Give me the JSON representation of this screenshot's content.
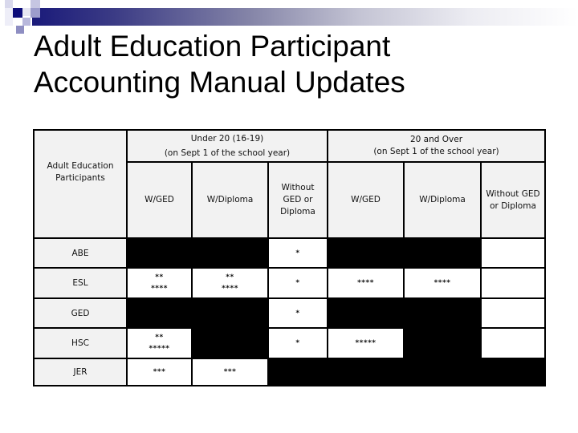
{
  "slide": {
    "title_lines": [
      "Adult Education Participant",
      "Accounting Manual Updates"
    ],
    "accent_colors": {
      "bar_dark": "#1a1a7a",
      "logo_dark": "#0d0d7a",
      "header_fill": "#f2f2f2",
      "blocked_fill": "#000000"
    }
  },
  "table": {
    "row_header_label": "Adult Education Participants",
    "groups": [
      {
        "label_lines": [
          "Under 20 (16-19)",
          "(on Sept 1 of the school year)"
        ]
      },
      {
        "label_lines": [
          "20 and Over",
          "(on Sept 1 of the school year)"
        ]
      }
    ],
    "columns": [
      {
        "label_lines": [
          "W/GED"
        ]
      },
      {
        "label_lines": [
          "W/Diploma"
        ]
      },
      {
        "label_lines": [
          "Without",
          "GED or",
          "Diploma"
        ]
      },
      {
        "label_lines": [
          "W/GED"
        ]
      },
      {
        "label_lines": [
          "W/Diploma"
        ]
      },
      {
        "label_lines": [
          "Without GED",
          "or Diploma"
        ]
      }
    ],
    "rows": [
      {
        "label": "ABE",
        "cells": [
          {
            "allowed": false,
            "marks": []
          },
          {
            "allowed": false,
            "marks": []
          },
          {
            "allowed": true,
            "marks": [
              "*"
            ]
          },
          {
            "allowed": false,
            "marks": []
          },
          {
            "allowed": false,
            "marks": []
          },
          {
            "allowed": true,
            "marks": []
          }
        ]
      },
      {
        "label": "ESL",
        "cells": [
          {
            "allowed": true,
            "marks": [
              "**",
              "****"
            ]
          },
          {
            "allowed": true,
            "marks": [
              "**",
              "****"
            ]
          },
          {
            "allowed": true,
            "marks": [
              "*"
            ]
          },
          {
            "allowed": true,
            "marks": [
              "****"
            ]
          },
          {
            "allowed": true,
            "marks": [
              "****"
            ]
          },
          {
            "allowed": true,
            "marks": []
          }
        ]
      },
      {
        "label": "GED",
        "cells": [
          {
            "allowed": false,
            "marks": []
          },
          {
            "allowed": false,
            "marks": []
          },
          {
            "allowed": true,
            "marks": [
              "*"
            ]
          },
          {
            "allowed": false,
            "marks": []
          },
          {
            "allowed": false,
            "marks": []
          },
          {
            "allowed": true,
            "marks": []
          }
        ]
      },
      {
        "label": "HSC",
        "cells": [
          {
            "allowed": true,
            "marks": [
              "**",
              "*****"
            ]
          },
          {
            "allowed": false,
            "marks": []
          },
          {
            "allowed": true,
            "marks": [
              "*"
            ]
          },
          {
            "allowed": true,
            "marks": [
              "*****"
            ]
          },
          {
            "allowed": false,
            "marks": []
          },
          {
            "allowed": true,
            "marks": []
          }
        ]
      },
      {
        "label": "JER",
        "cells": [
          {
            "allowed": true,
            "marks": [
              "***"
            ]
          },
          {
            "allowed": true,
            "marks": [
              "***"
            ]
          },
          {
            "allowed": false,
            "marks": []
          },
          {
            "allowed": false,
            "marks": []
          },
          {
            "allowed": false,
            "marks": []
          },
          {
            "allowed": false,
            "marks": []
          }
        ]
      }
    ]
  }
}
